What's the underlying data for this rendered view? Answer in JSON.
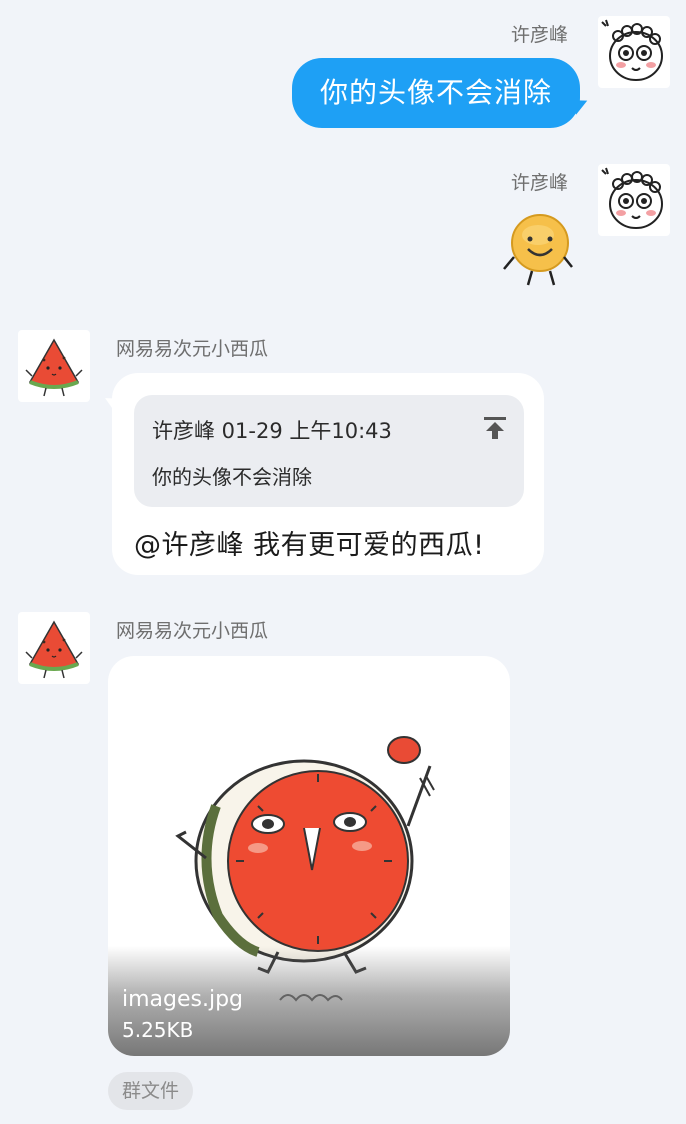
{
  "messages": {
    "m1": {
      "sender": "许彦峰",
      "text": "你的头像不会消除"
    },
    "m2": {
      "sender": "许彦峰"
    },
    "m3": {
      "sender": "网易易次元小西瓜",
      "quote": {
        "meta": "许彦峰 01-29 上午10:43",
        "text": "你的头像不会消除"
      },
      "text": "@许彦峰 我有更可爱的西瓜!"
    },
    "m4": {
      "sender": "网易易次元小西瓜",
      "file": {
        "name": "images.jpg",
        "size": "5.25KB"
      },
      "tag": "群文件"
    }
  },
  "colors": {
    "background": "#f1f4f9",
    "self_bubble": "#1ea0f5",
    "other_bubble": "#ffffff",
    "quote_bg": "#ebedf1",
    "tag_bg": "#e3e5e9"
  },
  "icons": [
    "doodle-face-avatar",
    "watermelon-avatar",
    "emoji-sticker",
    "jump-to-original-icon"
  ]
}
